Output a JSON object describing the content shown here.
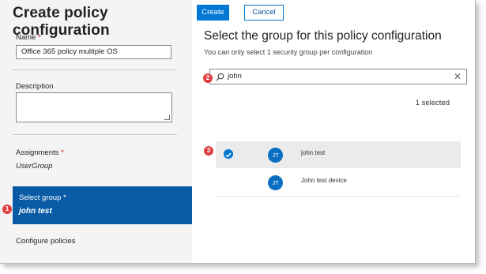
{
  "header": {
    "title": "Create policy configuration",
    "create_label": "Create",
    "cancel_label": "Cancel"
  },
  "form": {
    "name_label": "Name",
    "required_mark": "*",
    "name_value": "Office 365 policy multiple OS",
    "description_label": "Description",
    "description_value": ""
  },
  "nav": {
    "assignments_label": "Assignments",
    "assignments_value": "UserGroup",
    "select_group_label": "Select group",
    "select_group_value": "john test",
    "configure_label": "Configure policies"
  },
  "panel": {
    "heading": "Select the group for this policy configuration",
    "subtext": "You can only select 1 security group per configuration",
    "search_value": "john",
    "search_icon": "search-icon",
    "clear_icon": "close-icon",
    "selected_count": "1 selected",
    "results": [
      {
        "initials": "JT",
        "name": "john test",
        "selected": true
      },
      {
        "initials": "JT",
        "name": "John test device",
        "selected": false
      }
    ]
  },
  "callouts": [
    "1",
    "2",
    "3"
  ],
  "colors": {
    "accent": "#0078d4",
    "selected_band": "#0a5ba6",
    "callout": "#e04040"
  }
}
